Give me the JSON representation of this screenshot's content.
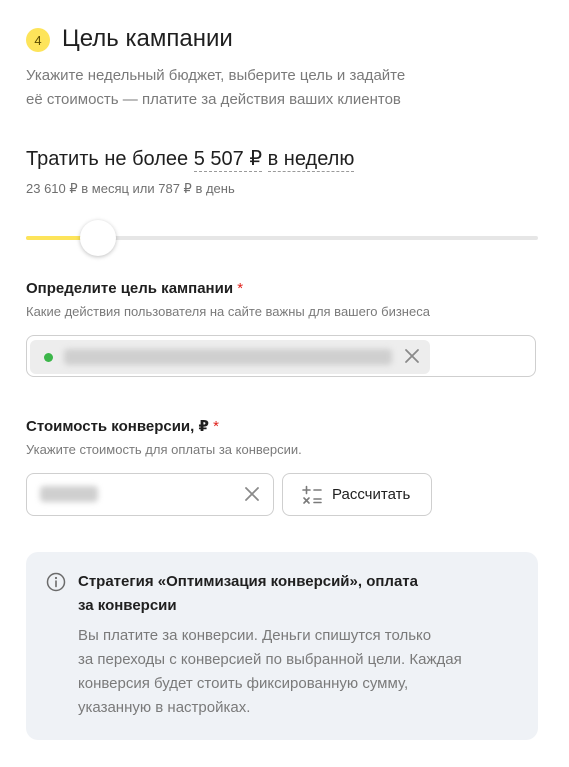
{
  "header": {
    "step_number": "4",
    "title": "Цель кампании",
    "subtitle_line1": "Укажите недельный бюджет, выберите цель и задайте",
    "subtitle_line2": "её стоимость — платите за действия ваших клиентов"
  },
  "budget": {
    "prefix": "Тратить не более",
    "amount": "5 507 ₽",
    "period": "в неделю",
    "summary": "23 610 ₽ в месяц или 787 ₽ в день",
    "slider_level_percent": 14,
    "colors": {
      "fill": "#fde45a",
      "track": "#e6e6e6"
    }
  },
  "goal": {
    "label": "Определите цель кампании",
    "required_mark": "*",
    "hint": "Какие действия пользователя на сайте важны для вашего бизнеса",
    "status_color": "#3cb64a",
    "clear_icon": "close-icon"
  },
  "conversion_cost": {
    "label": "Стоимость конверсии, ₽",
    "required_mark": "*",
    "hint": "Укажите стоимость для оплаты за конверсии.",
    "clear_icon": "close-icon",
    "calculate_button": "Рассчитать",
    "calculate_icon": "calculator-icon"
  },
  "info": {
    "icon": "info-icon",
    "title_line1": "Стратегия «Оптимизация конверсий», оплата",
    "title_line2": "за конверсии",
    "text_line1": "Вы платите за конверсии. Деньги спишутся только",
    "text_line2": "за переходы с конверсией по выбранной цели. Каждая",
    "text_line3": "конверсия будет стоить фиксированную сумму,",
    "text_line4": "указанную в настройках."
  }
}
